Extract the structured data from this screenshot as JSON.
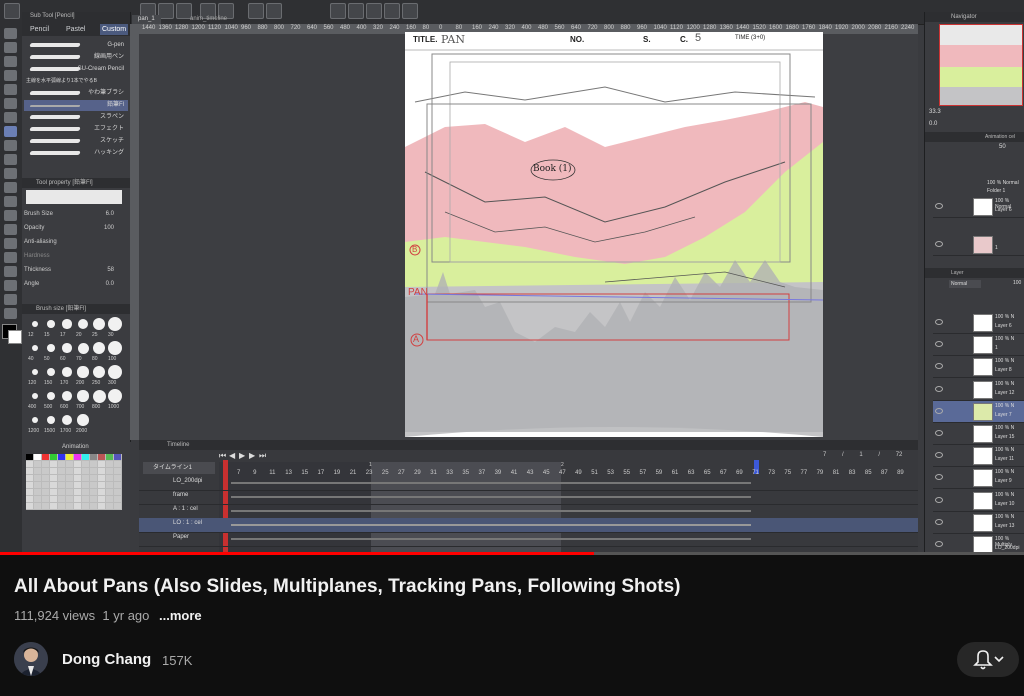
{
  "video": {
    "title": "All About Pans (Also Slides, Multiplanes, Tracking Pans, Following Shots)",
    "views": "111,924 views",
    "age": "1 yr ago",
    "more_label": "...more",
    "channel_name": "Dong Chang",
    "subscribers": "157K",
    "progress_fraction": 0.58
  },
  "app": {
    "subtool_tabs": [
      "Pencil",
      "Pastel",
      "Custom"
    ],
    "subtool_header": "Sub Tool [Pencil]",
    "brushes": [
      "G-pen",
      "線画用ペン",
      "SU-Cream Pencil",
      "主線を水平弧線より1本でやるB",
      "やわ筆ブラシ",
      "鉛筆Fl",
      "スラペン",
      "エフェクト",
      "スケッチ",
      "ハッキング"
    ],
    "tool_property_header": "Tool property [鉛筆Fl]",
    "properties": [
      {
        "label": "Brush Size",
        "value": "6.0"
      },
      {
        "label": "Opacity",
        "value": "100"
      },
      {
        "label": "Anti-aliasing",
        "value": ""
      },
      {
        "label": "Hardness",
        "value": ""
      },
      {
        "label": "Thickness",
        "value": "58"
      },
      {
        "label": "Angle",
        "value": "0.0"
      }
    ],
    "brush_size_header": "Brush size [鉛筆Fl]",
    "brush_sizes": [
      "12",
      "15",
      "17",
      "20",
      "25",
      "30",
      "40",
      "50",
      "60",
      "70",
      "80",
      "100",
      "120",
      "150",
      "170",
      "200",
      "250",
      "300",
      "400",
      "500",
      "600",
      "700",
      "800",
      "1000",
      "1200",
      "1500",
      "1700",
      "2000"
    ],
    "ruler_ticks": [
      "1440",
      "1360",
      "1280",
      "1200",
      "1120",
      "1040",
      "960",
      "880",
      "800",
      "720",
      "640",
      "560",
      "480",
      "400",
      "320",
      "240",
      "160",
      "80",
      "0",
      "80",
      "160",
      "240",
      "320",
      "400",
      "480",
      "560",
      "640",
      "720",
      "800",
      "880",
      "960",
      "1040",
      "1120",
      "1200",
      "1280",
      "1360",
      "1440",
      "1520",
      "1600",
      "1680",
      "1760",
      "1840",
      "1920",
      "2000",
      "2080",
      "2160",
      "2240"
    ],
    "canvas_tabs": [
      "pan_1",
      "anim_timeline"
    ],
    "paper": {
      "header_title": "TITLE.",
      "header_title_hand": "PAN",
      "header_no": "NO.",
      "header_s": "S.",
      "header_c": "C.",
      "header_c_hand": "5",
      "header_time": "TIME (3+0)",
      "book_label": "Book (1)",
      "pan_label": "PAN",
      "mark_a": "A",
      "mark_b": "B",
      "colors": {
        "mountain": "#f0b9bd",
        "hill": "#d9ef9d",
        "rock": "#c4c4c6",
        "line": "#d24040"
      }
    },
    "timeline": {
      "header": "Timeline",
      "track_name": "タイムライン1",
      "frames": [
        "7",
        "9",
        "11",
        "13",
        "15",
        "17",
        "19",
        "21",
        "23",
        "25",
        "27",
        "29",
        "31",
        "33",
        "35",
        "37",
        "39",
        "41",
        "43",
        "45",
        "47",
        "49",
        "51",
        "53",
        "55",
        "57",
        "59",
        "61",
        "63",
        "65",
        "67",
        "69",
        "71",
        "73",
        "75",
        "77",
        "79",
        "81",
        "83",
        "85",
        "87",
        "89"
      ],
      "counter": [
        "7",
        "/",
        "1",
        "/",
        "72"
      ],
      "tracks": [
        "LO_200dpi",
        "frame",
        "A : 1 : cel",
        "LO : 1 : cel",
        "Paper"
      ],
      "marker_1": "1",
      "marker_2": "2"
    },
    "navigator": {
      "header": "Navigator",
      "zoom": "33.3",
      "angle": "0.0",
      "anim_header": "Animation cel",
      "anim_value": "50",
      "folder_mode": "100 % Normal",
      "folder_name": "Folder 1",
      "layer_header": "Layer",
      "blend": "Normal",
      "opacity": "100"
    },
    "layers": [
      {
        "mode": "100 % Normal",
        "name": "Layer 6",
        "thumb": "white"
      },
      {
        "mode": "",
        "name": "1",
        "thumb": "red"
      },
      {
        "mode": "100 % N",
        "name": "Layer 6",
        "thumb": "white"
      },
      {
        "mode": "100 % N",
        "name": "1",
        "thumb": "white"
      },
      {
        "mode": "100 % N",
        "name": "Layer 8",
        "thumb": "white"
      },
      {
        "mode": "100 % N",
        "name": "Layer 12",
        "thumb": "white"
      },
      {
        "mode": "100 % N",
        "name": "Layer 7",
        "thumb": "green"
      },
      {
        "mode": "100 % N",
        "name": "Layer 15",
        "thumb": "white"
      },
      {
        "mode": "100 % N",
        "name": "Layer 11",
        "thumb": "white"
      },
      {
        "mode": "100 % N",
        "name": "Layer 9",
        "thumb": "white"
      },
      {
        "mode": "100 % N",
        "name": "Layer 10",
        "thumb": "white"
      },
      {
        "mode": "100 % N",
        "name": "Layer 13",
        "thumb": "white"
      },
      {
        "mode": "100 % Multiply",
        "name": "LO_200dpi",
        "thumb": "white"
      }
    ]
  }
}
